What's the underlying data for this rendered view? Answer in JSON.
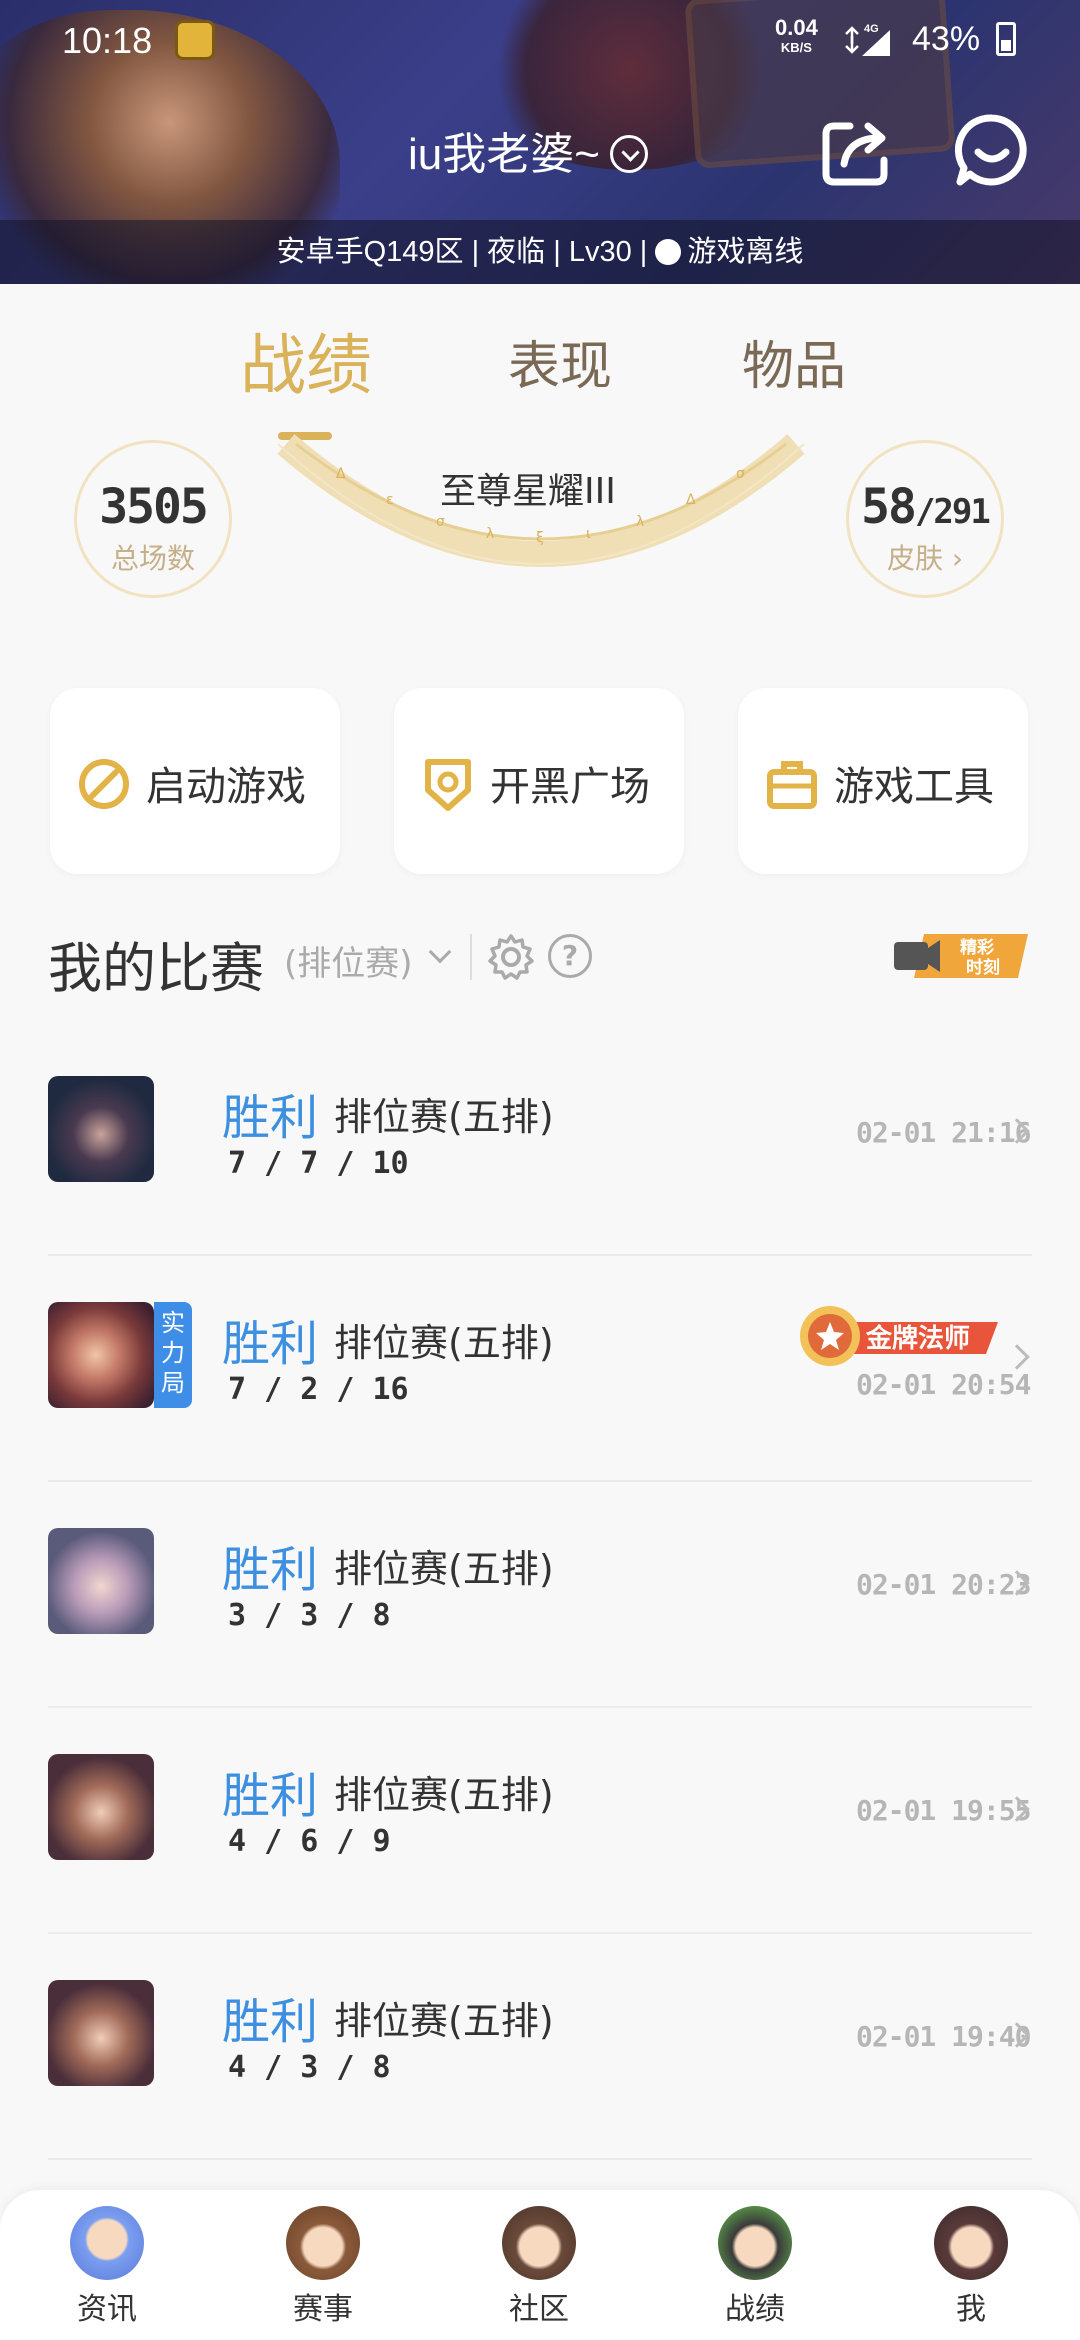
{
  "status_bar": {
    "time": "10:18",
    "speed_value": "0.04",
    "speed_unit": "KB/S",
    "network": "4G",
    "battery": "43%"
  },
  "header": {
    "account_name": "iu我老婆~",
    "info_line": "安卓手Q149区 | 夜临 | Lv30 | ",
    "online_status": "游戏离线"
  },
  "tabs": [
    {
      "label": "战绩"
    },
    {
      "label": "表现"
    },
    {
      "label": "物品"
    }
  ],
  "stats": {
    "total_games": "3505",
    "total_games_label": "总场数",
    "rank": "至尊星耀III",
    "skins_owned": "58",
    "skins_total": "/291",
    "skins_label": "皮肤"
  },
  "quick_actions": [
    {
      "label": "启动游戏",
      "icon": "launch-icon"
    },
    {
      "label": "开黑广场",
      "icon": "shield-icon"
    },
    {
      "label": "游戏工具",
      "icon": "toolbox-icon"
    }
  ],
  "matches_section": {
    "title": "我的比赛",
    "filter": "(排位赛)",
    "highlights_label_1": "精彩",
    "highlights_label_2": "时刻"
  },
  "matches": [
    {
      "result": "胜利",
      "mode": "排位赛(五排)",
      "kda": "7 / 7 / 10",
      "time": "02-01 21:16"
    },
    {
      "result": "胜利",
      "mode": "排位赛(五排)",
      "kda": "7 / 2 / 16",
      "time": "02-01 20:54",
      "tag": "实力局",
      "medal": "金牌法师"
    },
    {
      "result": "胜利",
      "mode": "排位赛(五排)",
      "kda": "3 / 3 / 8",
      "time": "02-01 20:23"
    },
    {
      "result": "胜利",
      "mode": "排位赛(五排)",
      "kda": "4 / 6 / 9",
      "time": "02-01 19:55"
    },
    {
      "result": "胜利",
      "mode": "排位赛(五排)",
      "kda": "4 / 3 / 8",
      "time": "02-01 19:40"
    }
  ],
  "bottom_nav": [
    {
      "label": "资讯"
    },
    {
      "label": "赛事"
    },
    {
      "label": "社区"
    },
    {
      "label": "战绩"
    },
    {
      "label": "我"
    }
  ],
  "colors": {
    "accent_gold": "#d9b25a",
    "win_blue": "#3d8fe0",
    "tag_blue": "#3e8ee8"
  }
}
